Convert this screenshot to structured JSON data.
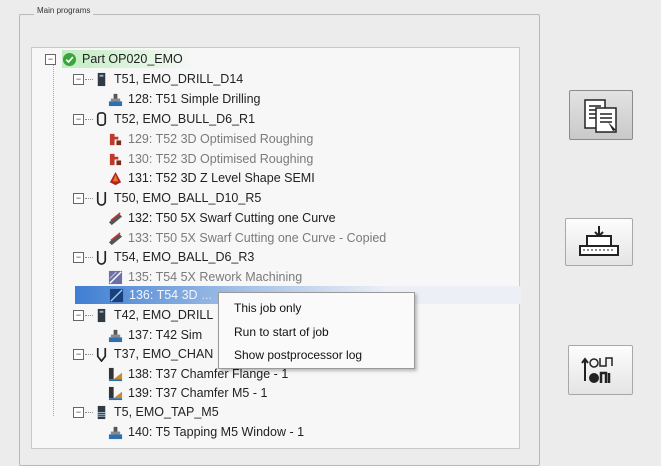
{
  "group": {
    "title": "Main programs"
  },
  "tree": {
    "part": {
      "label": "Part OP020_EMO",
      "status_color": "#3aa63a"
    },
    "tools": [
      {
        "label": "T51, EMO_DRILL_D14",
        "icon": "drill-tool-icon",
        "jobs": [
          {
            "label": "128: T51 Simple Drilling",
            "icon": "drilling-op-icon",
            "dimmed": false
          }
        ]
      },
      {
        "label": "T52, EMO_BULL_D6_R1",
        "icon": "bull-nose-tool-icon",
        "jobs": [
          {
            "label": "129: T52 3D Optimised Roughing",
            "icon": "roughing-op-icon",
            "dimmed": true
          },
          {
            "label": "130: T52 3D Optimised Roughing",
            "icon": "roughing-op-icon",
            "dimmed": true
          },
          {
            "label": "131: T52 3D Z Level Shape SEMI",
            "icon": "z-level-op-icon",
            "dimmed": false
          }
        ]
      },
      {
        "label": "T50, EMO_BALL_D10_R5",
        "icon": "ball-tool-icon",
        "jobs": [
          {
            "label": "132: T50 5X Swarf Cutting one Curve",
            "icon": "swarf-op-icon",
            "dimmed": false
          },
          {
            "label": "133: T50 5X Swarf Cutting one Curve - Copied",
            "icon": "swarf-op-icon",
            "dimmed": true
          }
        ]
      },
      {
        "label": "T54, EMO_BALL_D6_R3",
        "icon": "ball-tool-icon",
        "jobs": [
          {
            "label": "135: T54 5X Rework Machining",
            "icon": "rework-op-icon",
            "dimmed": false
          },
          {
            "label": "136: T54 3D",
            "label_suffix": "...",
            "icon": "finishing-op-icon",
            "dimmed": false
          }
        ]
      },
      {
        "label": "T42, EMO_DRILL",
        "icon": "drill-tool-icon",
        "jobs": [
          {
            "label": "137: T42 Sim",
            "icon": "drilling-op-icon",
            "dimmed": false
          }
        ]
      },
      {
        "label": "T37, EMO_CHAN",
        "icon": "chamfer-tool-icon",
        "jobs": [
          {
            "label": "138: T37 Chamfer Flange - 1",
            "icon": "chamfer-op-icon",
            "dimmed": false
          },
          {
            "label": "139: T37 Chamfer M5 - 1",
            "icon": "chamfer-op-icon",
            "dimmed": false
          }
        ]
      },
      {
        "label": "T5, EMO_TAP_M5",
        "icon": "tap-tool-icon",
        "jobs": [
          {
            "label": "140: T5 Tapping M5 Window - 1",
            "icon": "tapping-op-icon",
            "dimmed": false
          }
        ]
      }
    ]
  },
  "context_menu": {
    "items": [
      "This job only",
      "Run to start of job",
      "Show postprocessor log"
    ]
  },
  "side_buttons": [
    {
      "name": "program-list-button",
      "icon": "program-list-icon"
    },
    {
      "name": "machine-button",
      "icon": "machine-table-icon"
    },
    {
      "name": "toggle-output-button",
      "icon": "toggle-output-icon"
    }
  ]
}
